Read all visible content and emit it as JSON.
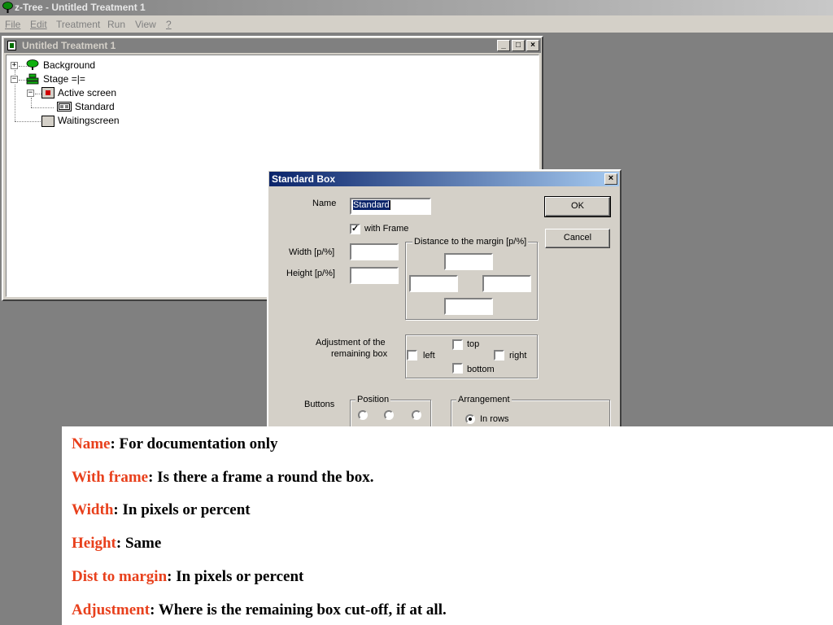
{
  "app": {
    "title": "z-Tree - Untitled Treatment 1",
    "menu": [
      {
        "label": "File",
        "accel": "F"
      },
      {
        "label": "Edit",
        "accel": "E"
      },
      {
        "label": "Treatment",
        "accel": ""
      },
      {
        "label": "Run",
        "accel": ""
      },
      {
        "label": "View",
        "accel": ""
      },
      {
        "label": "?",
        "accel": "?"
      }
    ]
  },
  "treatment_window": {
    "title": "Untitled Treatment 1",
    "minimize": "_",
    "restore": "□",
    "close": "×",
    "tree": [
      {
        "label": "Background",
        "icon": "background-globe-icon",
        "expander": "+"
      },
      {
        "label": "Stage =|=",
        "icon": "stage-icon",
        "expander": "−"
      },
      {
        "label": "Active screen",
        "icon": "active-screen-icon",
        "expander": "−"
      },
      {
        "label": "Standard",
        "icon": "standard-box-icon",
        "expander": ""
      },
      {
        "label": "Waitingscreen",
        "icon": "waiting-screen-icon",
        "expander": ""
      }
    ]
  },
  "dialog": {
    "title": "Standard Box",
    "close": "×",
    "name_label": "Name",
    "name_value": "Standard",
    "with_frame_label": "with Frame",
    "with_frame_checked": "✓",
    "width_label": "Width [p/%]",
    "width_value": "",
    "height_label": "Height [p/%]",
    "height_value": "",
    "distance_group": "Distance to the margin [p/%]",
    "adjustment_label_1": "Adjustment of the",
    "adjustment_label_2": "remaining box",
    "adj_top": "top",
    "adj_left": "left",
    "adj_right": "right",
    "adj_bottom": "bottom",
    "buttons_label": "Buttons",
    "position_group": "Position",
    "arrangement_group": "Arrangement",
    "arrangement_in_rows": "In rows",
    "ok": "OK",
    "cancel": "Cancel"
  },
  "notes": [
    {
      "term": "Name",
      "text": ": For documentation only"
    },
    {
      "term": "With frame",
      "text": ": Is there a frame a round the box."
    },
    {
      "term": "Width",
      "text": ": In pixels or percent"
    },
    {
      "term": "Height",
      "text": ": Same"
    },
    {
      "term": "Dist to margin",
      "text": ": In pixels or percent"
    },
    {
      "term": "Adjustment",
      "text": ": Where is the remaining box cut-off, if at all."
    }
  ],
  "colors": {
    "term": "#e8401c",
    "dialog_title_start": "#0a246a",
    "desktop": "#808080"
  }
}
